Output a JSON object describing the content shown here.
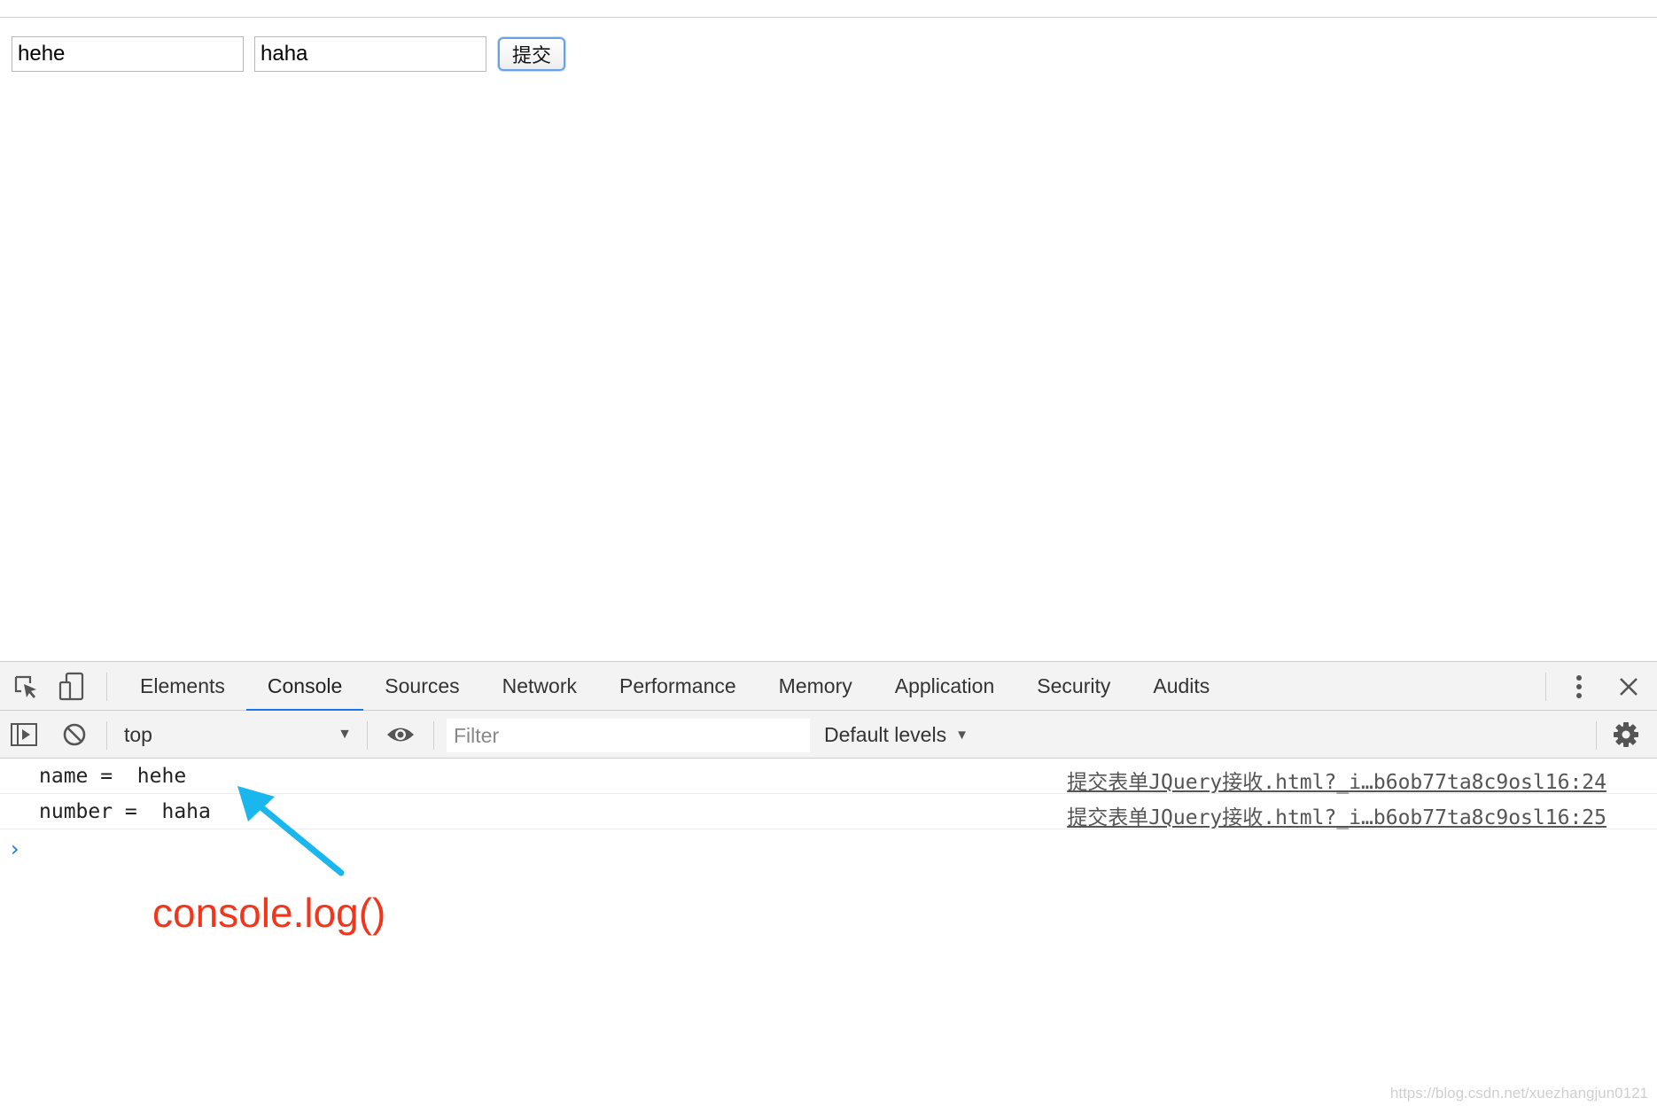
{
  "page": {
    "name_value": "hehe",
    "number_value": "haha",
    "submit_label": "提交"
  },
  "devtools": {
    "tabs": [
      {
        "label": "Elements",
        "active": false
      },
      {
        "label": "Console",
        "active": true
      },
      {
        "label": "Sources",
        "active": false
      },
      {
        "label": "Network",
        "active": false
      },
      {
        "label": "Performance",
        "active": false
      },
      {
        "label": "Memory",
        "active": false
      },
      {
        "label": "Application",
        "active": false
      },
      {
        "label": "Security",
        "active": false
      },
      {
        "label": "Audits",
        "active": false
      }
    ],
    "context": "top",
    "filter_placeholder": "Filter",
    "levels_label": "Default levels",
    "accent_color": "#1a73e8",
    "logs": [
      {
        "message": "name =  hehe",
        "source": "提交表单JQuery接收.html?_i…b6ob77ta8c9osl16:24"
      },
      {
        "message": "number =  haha",
        "source": "提交表单JQuery接收.html?_i…b6ob77ta8c9osl16:25"
      }
    ],
    "prompt_symbol": "›"
  },
  "annotation": {
    "label": "console.log()",
    "label_color": "#f2361c",
    "arrow_color": "#1ab6ee"
  },
  "watermark": "https://blog.csdn.net/xuezhangjun0121"
}
